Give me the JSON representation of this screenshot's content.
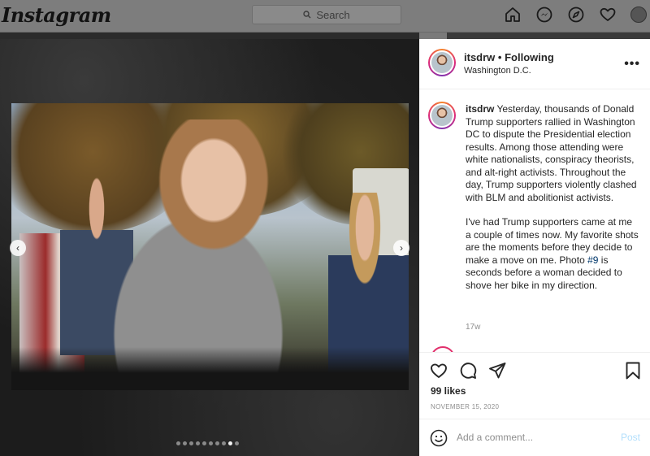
{
  "brand": {
    "logo_text": "Instagram"
  },
  "search": {
    "placeholder": "Search",
    "icon": "search-icon"
  },
  "nav": {
    "icons": [
      "home-icon",
      "messenger-icon",
      "explore-icon",
      "heart-icon",
      "profile-avatar"
    ]
  },
  "carousel": {
    "slide_count": 10,
    "active_index": 8
  },
  "post": {
    "username": "itsdrw",
    "separator": "•",
    "follow_status": "Following",
    "location": "Washington D.C.",
    "more_label": "•••",
    "caption_username": "itsdrw",
    "caption_p1": "Yesterday, thousands of Donald Trump supporters rallied in Washington DC to dispute the Presidential election results. Among those attending were white nationalists, conspiracy theorists, and alt-right activists. Throughout the day, Trump supporters violently clashed with BLM and abolitionist activists.",
    "caption_p2_before": "I've had Trump supporters came at me a couple of times now. My favorite shots are the moments before they decide to make a move on me. Photo ",
    "caption_hashtag": "#9",
    "caption_p2_after": " is seconds before a woman decided to shove her bike in my direction.",
    "age": "17w",
    "likes": "99 likes",
    "date": "NOVEMBER 15, 2020"
  },
  "comment": {
    "placeholder": "Add a comment...",
    "post_label": "Post"
  },
  "colors": {
    "accent_link": "#00376b",
    "post_disabled": "#b2dffc",
    "muted": "#8e8e8e"
  }
}
